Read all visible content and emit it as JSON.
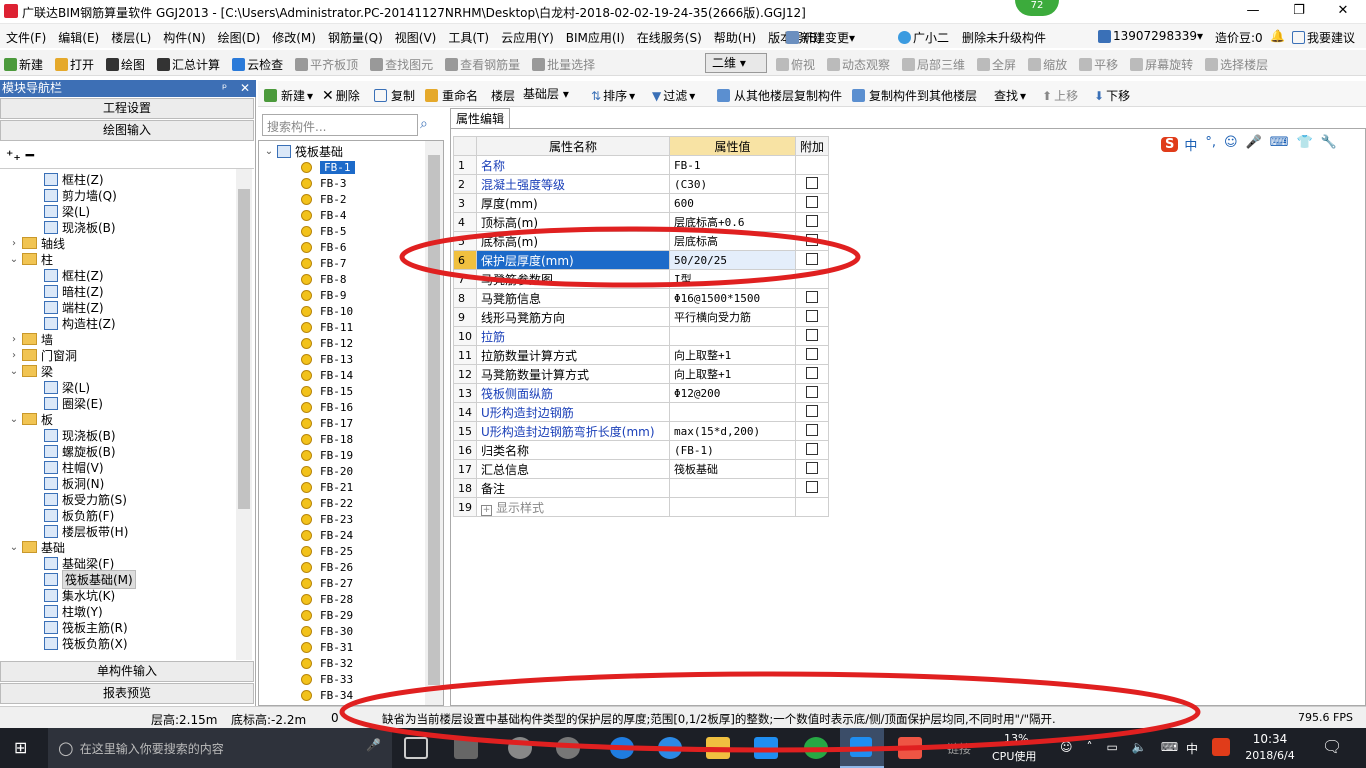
{
  "window": {
    "title": "广联达BIM钢筋算量软件 GGJ2013 - [C:\\Users\\Administrator.PC-20141127NRHM\\Desktop\\白龙村-2018-02-02-19-24-35(2666版).GGJ12]",
    "badge": "72",
    "min": "—",
    "max": "❐",
    "close": "✕"
  },
  "menu": {
    "items": [
      "文件(F)",
      "编辑(E)",
      "楼层(L)",
      "构件(N)",
      "绘图(D)",
      "修改(M)",
      "钢筋量(Q)",
      "视图(V)",
      "工具(T)",
      "云应用(Y)",
      "BIM应用(I)",
      "在线服务(S)",
      "帮助(H)",
      "版本号(B)"
    ],
    "new_change": "新建变更",
    "guangxiaoer": "广小二",
    "delete_unupgraded": "删除未升级构件",
    "phone": "13907298339",
    "cost_beans": "造价豆:0",
    "suggest": "我要建议"
  },
  "toolbar1": {
    "items": [
      "新建",
      "打开",
      "绘图",
      "汇总计算",
      "云检查",
      "平齐板顶",
      "查找图元",
      "查看钢筋量",
      "批量选择"
    ],
    "view_mode": "二维",
    "items2": [
      "俯视",
      "动态观察",
      "局部三维",
      "全屏",
      "缩放",
      "平移",
      "屏幕旋转",
      "选择楼层"
    ]
  },
  "toolbar2": {
    "new": "新建",
    "delete": "删除",
    "copy": "复制",
    "rename": "重命名",
    "floor_label": "楼层",
    "floor_value": "基础层",
    "sort": "排序",
    "filter": "过滤",
    "copy_from": "从其他楼层复制构件",
    "copy_to": "复制构件到其他楼层",
    "find": "查找",
    "move_up": "上移",
    "move_down": "下移"
  },
  "left_panel": {
    "header": "模块导航栏",
    "pin": "ᵖ",
    "close": "✕",
    "btn_project": "工程设置",
    "btn_draw": "绘图输入",
    "btn_single": "单构件输入",
    "btn_report": "报表预览",
    "tree": [
      {
        "label": "框柱(Z)",
        "type": "item",
        "indent": 2
      },
      {
        "label": "剪力墙(Q)",
        "type": "item",
        "indent": 2
      },
      {
        "label": "梁(L)",
        "type": "item",
        "indent": 2
      },
      {
        "label": "现浇板(B)",
        "type": "item",
        "indent": 2
      },
      {
        "label": "轴线",
        "type": "folder",
        "indent": 0,
        "exp": "›"
      },
      {
        "label": "柱",
        "type": "folder",
        "indent": 0,
        "exp": "⌄"
      },
      {
        "label": "框柱(Z)",
        "type": "item",
        "indent": 2
      },
      {
        "label": "暗柱(Z)",
        "type": "item",
        "indent": 2
      },
      {
        "label": "端柱(Z)",
        "type": "item",
        "indent": 2
      },
      {
        "label": "构造柱(Z)",
        "type": "item",
        "indent": 2
      },
      {
        "label": "墙",
        "type": "folder",
        "indent": 0,
        "exp": "›"
      },
      {
        "label": "门窗洞",
        "type": "folder",
        "indent": 0,
        "exp": "›"
      },
      {
        "label": "梁",
        "type": "folder",
        "indent": 0,
        "exp": "⌄"
      },
      {
        "label": "梁(L)",
        "type": "item",
        "indent": 2
      },
      {
        "label": "圈梁(E)",
        "type": "item",
        "indent": 2
      },
      {
        "label": "板",
        "type": "folder",
        "indent": 0,
        "exp": "⌄"
      },
      {
        "label": "现浇板(B)",
        "type": "item",
        "indent": 2
      },
      {
        "label": "螺旋板(B)",
        "type": "item",
        "indent": 2
      },
      {
        "label": "柱帽(V)",
        "type": "item",
        "indent": 2
      },
      {
        "label": "板洞(N)",
        "type": "item",
        "indent": 2
      },
      {
        "label": "板受力筋(S)",
        "type": "item",
        "indent": 2
      },
      {
        "label": "板负筋(F)",
        "type": "item",
        "indent": 2
      },
      {
        "label": "楼层板带(H)",
        "type": "item",
        "indent": 2
      },
      {
        "label": "基础",
        "type": "folder",
        "indent": 0,
        "exp": "⌄"
      },
      {
        "label": "基础梁(F)",
        "type": "item",
        "indent": 2
      },
      {
        "label": "筏板基础(M)",
        "type": "item",
        "indent": 2,
        "selected": true
      },
      {
        "label": "集水坑(K)",
        "type": "item",
        "indent": 2
      },
      {
        "label": "柱墩(Y)",
        "type": "item",
        "indent": 2
      },
      {
        "label": "筏板主筋(R)",
        "type": "item",
        "indent": 2
      },
      {
        "label": "筏板负筋(X)",
        "type": "item",
        "indent": 2
      }
    ]
  },
  "mid_panel": {
    "search_placeholder": "搜索构件...",
    "root": "筏板基础",
    "items": [
      "FB-1",
      "FB-3",
      "FB-2",
      "FB-4",
      "FB-5",
      "FB-6",
      "FB-7",
      "FB-8",
      "FB-9",
      "FB-10",
      "FB-11",
      "FB-12",
      "FB-13",
      "FB-14",
      "FB-15",
      "FB-16",
      "FB-17",
      "FB-18",
      "FB-19",
      "FB-20",
      "FB-21",
      "FB-22",
      "FB-23",
      "FB-24",
      "FB-25",
      "FB-26",
      "FB-27",
      "FB-28",
      "FB-29",
      "FB-30",
      "FB-31",
      "FB-32",
      "FB-33",
      "FB-34"
    ]
  },
  "prop_panel": {
    "tab": "属性编辑",
    "col_name": "属性名称",
    "col_value": "属性值",
    "col_extra": "附加",
    "rows": [
      {
        "n": "1",
        "name": "名称",
        "value": "FB-1",
        "blue": true,
        "cb": false
      },
      {
        "n": "2",
        "name": "混凝土强度等级",
        "value": "(C30)",
        "blue": true,
        "cb": true
      },
      {
        "n": "3",
        "name": "厚度(mm)",
        "value": "600",
        "blue": false,
        "cb": true
      },
      {
        "n": "4",
        "name": "顶标高(m)",
        "value": "层底标高+0.6",
        "blue": false,
        "cb": true
      },
      {
        "n": "5",
        "name": "底标高(m)",
        "value": "层底标高",
        "blue": false,
        "cb": true
      },
      {
        "n": "6",
        "name": "保护层厚度(mm)",
        "value": "50/20/25",
        "blue": false,
        "cb": true,
        "selected": true
      },
      {
        "n": "7",
        "name": "马凳筋参数图",
        "value": "I型",
        "blue": false,
        "cb": false
      },
      {
        "n": "8",
        "name": "马凳筋信息",
        "value": "Φ16@1500*1500",
        "blue": false,
        "cb": true
      },
      {
        "n": "9",
        "name": "线形马凳筋方向",
        "value": "平行横向受力筋",
        "blue": false,
        "cb": true
      },
      {
        "n": "10",
        "name": "拉筋",
        "value": "",
        "blue": true,
        "cb": true
      },
      {
        "n": "11",
        "name": "拉筋数量计算方式",
        "value": "向上取整+1",
        "blue": false,
        "cb": true
      },
      {
        "n": "12",
        "name": "马凳筋数量计算方式",
        "value": "向上取整+1",
        "blue": false,
        "cb": true
      },
      {
        "n": "13",
        "name": "筏板侧面纵筋",
        "value": "Φ12@200",
        "blue": true,
        "cb": true
      },
      {
        "n": "14",
        "name": "U形构造封边钢筋",
        "value": "",
        "blue": true,
        "cb": true
      },
      {
        "n": "15",
        "name": "U形构造封边钢筋弯折长度(mm)",
        "value": "max(15*d,200)",
        "blue": true,
        "cb": true
      },
      {
        "n": "16",
        "name": "归类名称",
        "value": "(FB-1)",
        "blue": false,
        "cb": true
      },
      {
        "n": "17",
        "name": "汇总信息",
        "value": "筏板基础",
        "blue": false,
        "cb": true
      },
      {
        "n": "18",
        "name": "备注",
        "value": "",
        "blue": false,
        "cb": true
      },
      {
        "n": "19",
        "name": "显示样式",
        "value": "",
        "blue": false,
        "cb": false,
        "grey": true,
        "plus": true
      }
    ]
  },
  "ime": {
    "s": "S",
    "items": [
      "中",
      "°,",
      "☺",
      "🎤",
      "⌨",
      "👕",
      "🔧"
    ]
  },
  "status": {
    "floor_height": "层高:2.15m",
    "base_elev": "底标高:-2.2m",
    "zero": "0",
    "hint": "缺省为当前楼层设置中基础构件类型的保护层的厚度;范围[0,1/2板厚]的整数;一个数值时表示底/侧/顶面保护层均同,不同时用\"/\"隔开.",
    "fps": "795.6 FPS"
  },
  "taskbar": {
    "search_placeholder": "在这里输入你要搜索的内容",
    "cpu_pct": "13%",
    "cpu_label": "CPU使用",
    "link": "链接",
    "ime": "中",
    "time": "10:34",
    "date": "2018/6/4"
  },
  "colors": {
    "accent": "#3d6fb5",
    "selected": "#1c6ac9",
    "header_value": "#f8e3a4",
    "annotation": "#e02020"
  }
}
